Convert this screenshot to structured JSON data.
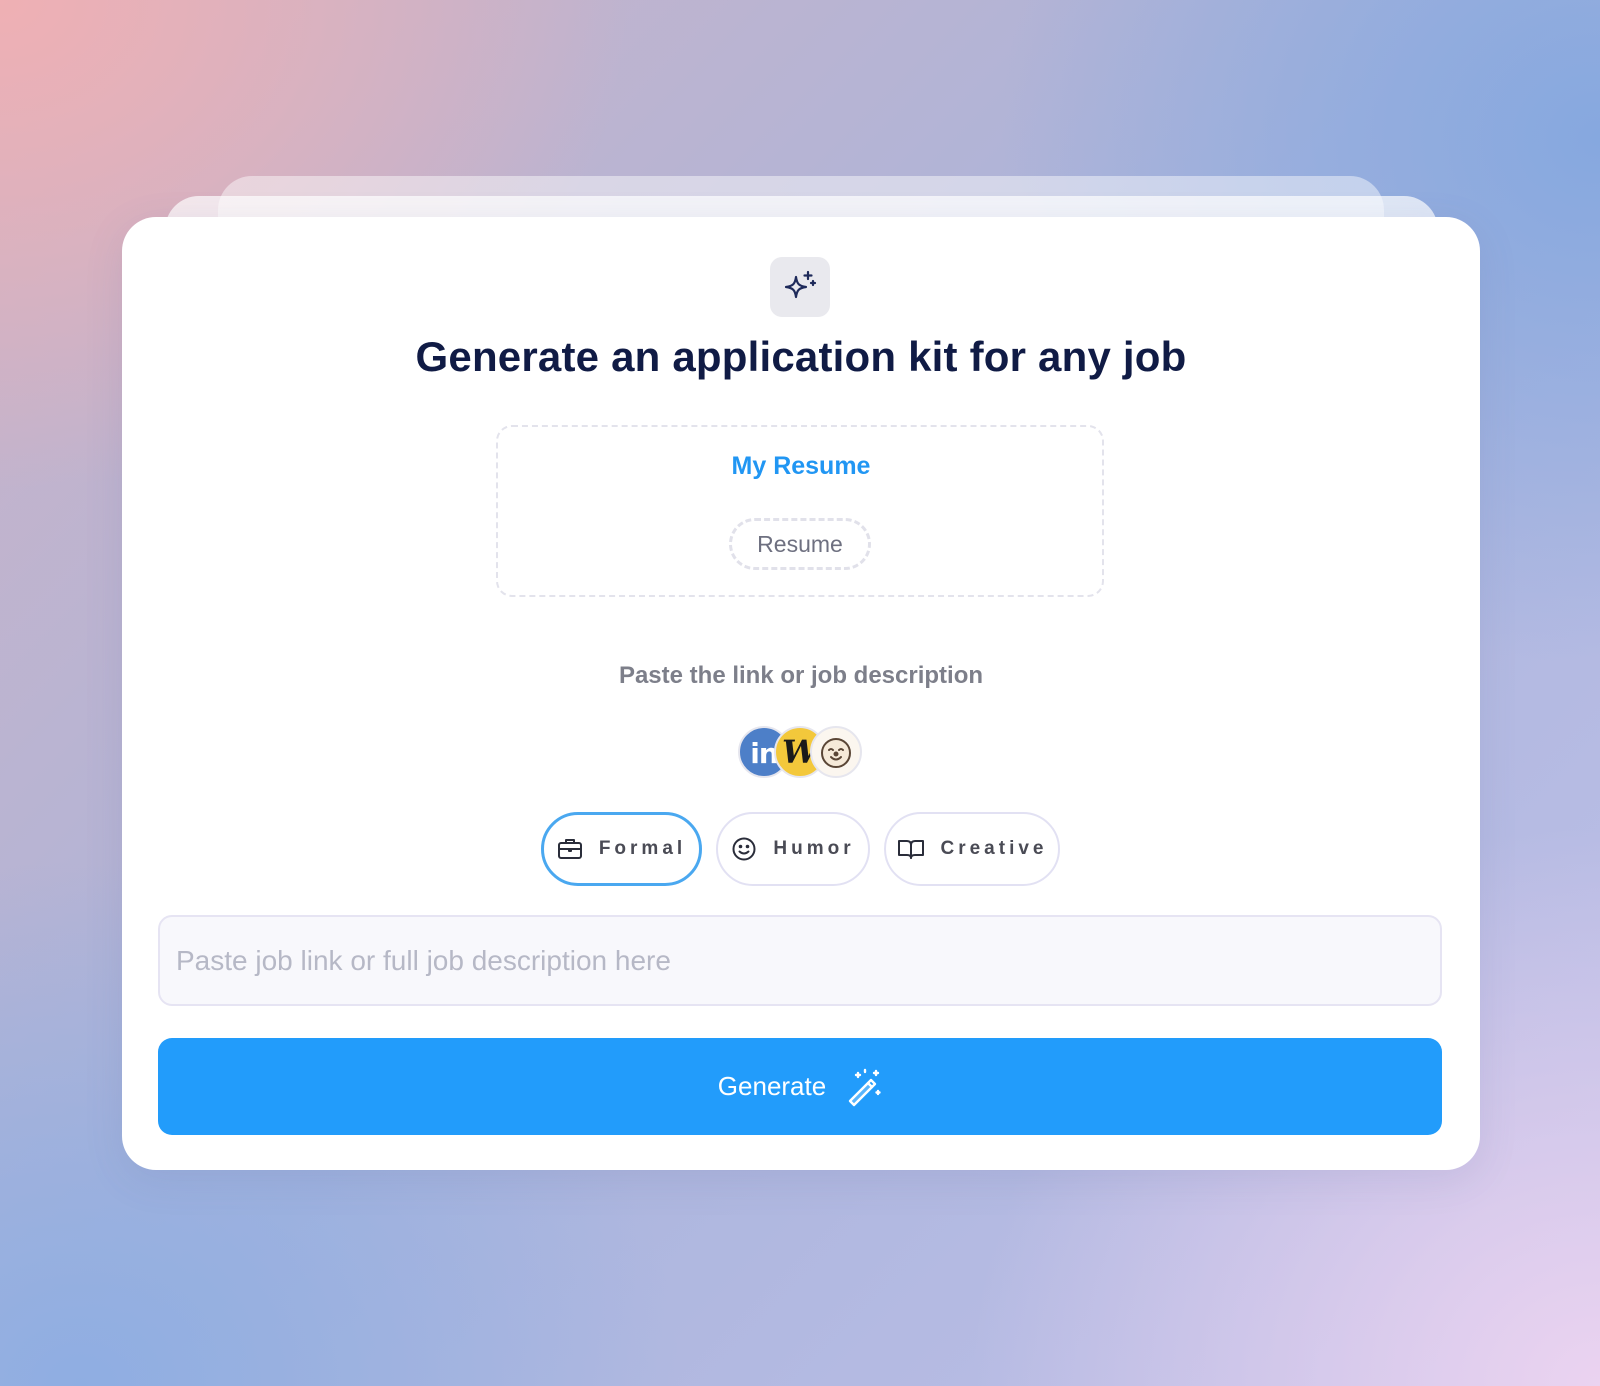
{
  "header": {
    "title": "Generate an application kit for any job",
    "icon": "sparkles-icon"
  },
  "resume": {
    "title": "My Resume",
    "chip_label": "Resume"
  },
  "job_source": {
    "label": "Paste the link or job description",
    "logos": [
      "linkedin-logo",
      "w-logo",
      "otta-logo"
    ],
    "logo_text": {
      "linkedin": "in",
      "w": "W"
    }
  },
  "tones": [
    {
      "label": "Formal",
      "icon": "briefcase-icon",
      "selected": true
    },
    {
      "label": "Humor",
      "icon": "smile-icon",
      "selected": false
    },
    {
      "label": "Creative",
      "icon": "open-book-icon",
      "selected": false
    }
  ],
  "input": {
    "value": "",
    "placeholder": "Paste job link or full job description here"
  },
  "generate_button": {
    "label": "Generate",
    "icon": "magic-wand-icon"
  },
  "colors": {
    "accent": "#229cfb",
    "title": "#101b45",
    "resume_title": "#2196f3"
  }
}
